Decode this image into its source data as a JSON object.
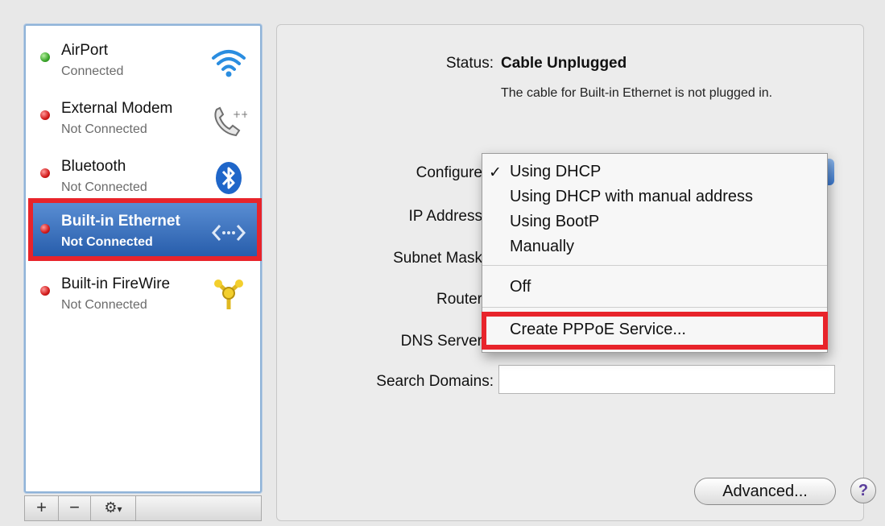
{
  "services": [
    {
      "name": "AirPort",
      "status": "Connected",
      "dot": "green",
      "icon": "wifi-icon"
    },
    {
      "name": "External Modem",
      "status": "Not Connected",
      "dot": "red",
      "icon": "phone-icon"
    },
    {
      "name": "Bluetooth",
      "status": "Not Connected",
      "dot": "red",
      "icon": "bluetooth-icon"
    },
    {
      "name": "Built-in Ethernet",
      "status": "Not Connected",
      "dot": "red",
      "icon": "ethernet-icon",
      "selected": true
    },
    {
      "name": "Built-in FireWire",
      "status": "Not Connected",
      "dot": "red",
      "icon": "firewire-icon"
    }
  ],
  "toolbar": {
    "add": "+",
    "remove": "−",
    "gear": "⚙"
  },
  "status": {
    "label": "Status:",
    "value": "Cable Unplugged",
    "description": "The cable for Built-in Ethernet is not plugged in."
  },
  "labels": {
    "configure": "Configure",
    "ip_address": "IP Address",
    "subnet_mask": "Subnet Mask",
    "router": "Router",
    "dns_server": "DNS Server",
    "search_domains": "Search Domains:"
  },
  "menu": {
    "check": "✓",
    "items": [
      "Using DHCP",
      "Using DHCP with manual address",
      "Using BootP",
      "Manually",
      "Off",
      "Create PPPoE Service..."
    ],
    "selected_index": 0
  },
  "buttons": {
    "advanced": "Advanced...",
    "help": "?"
  },
  "colors": {
    "highlight": "#e8242b",
    "selection": "#2f64b3"
  }
}
